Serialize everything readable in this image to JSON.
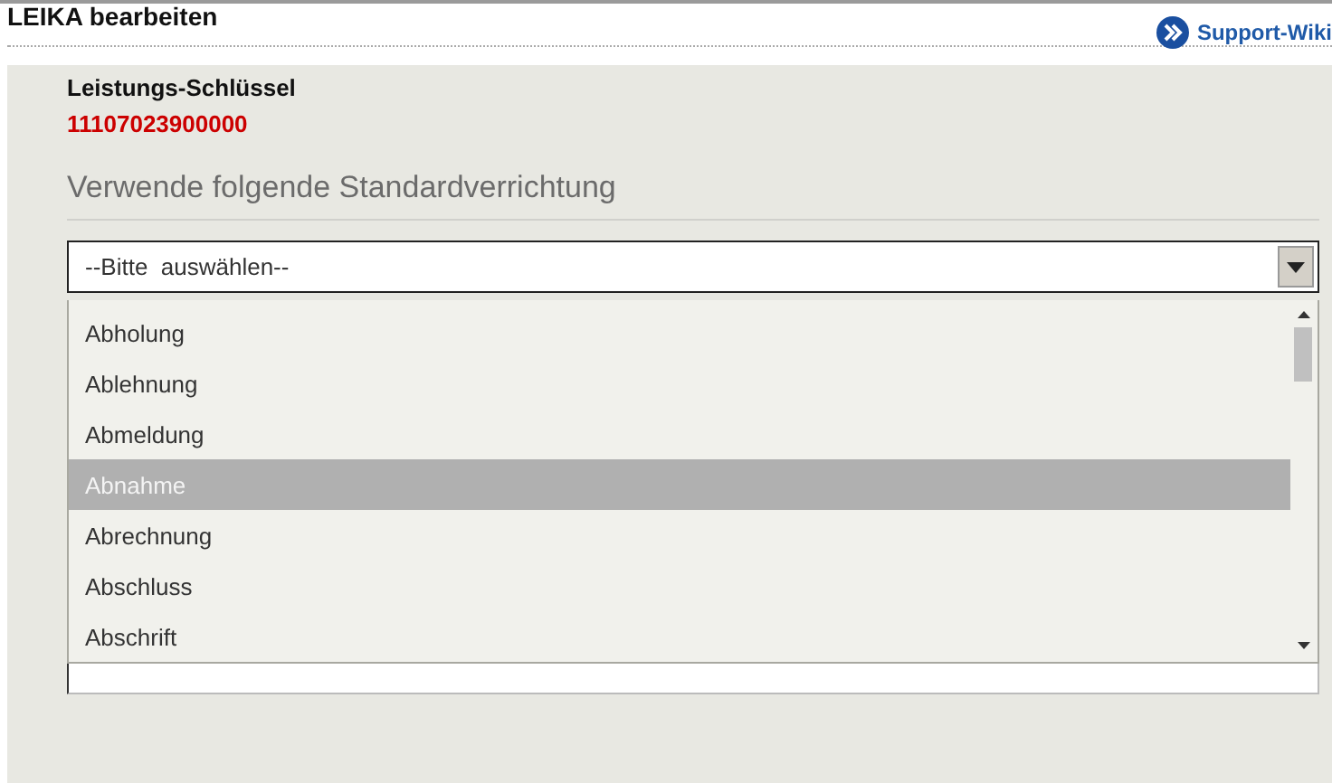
{
  "page_title": "LEIKA bearbeiten",
  "help_link": "Support-Wiki",
  "key_field": {
    "label": "Leistungs-Schlüssel",
    "value": "11107023900000"
  },
  "section_heading": "Verwende folgende Standardverrichtung",
  "select": {
    "value": "--Bitte  auswählen--",
    "expanded": true,
    "options": [
      {
        "label": "Abholung",
        "selected": false
      },
      {
        "label": "Ablehnung",
        "selected": false
      },
      {
        "label": "Abmeldung",
        "selected": false
      },
      {
        "label": "Abnahme",
        "selected": true
      },
      {
        "label": "Abrechnung",
        "selected": false
      },
      {
        "label": "Abschluss",
        "selected": false
      },
      {
        "label": "Abschrift",
        "selected": false
      }
    ]
  }
}
